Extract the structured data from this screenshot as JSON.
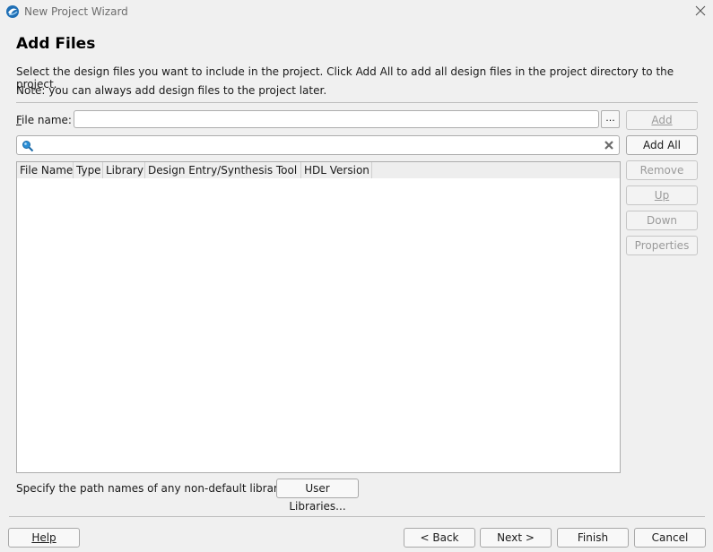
{
  "window": {
    "title": "New Project Wizard",
    "icon": "vivado-app-icon",
    "close_icon": "close-icon"
  },
  "page": {
    "heading": "Add Files",
    "description_line1": "Select the design files you want to include in the project. Click Add All to add all design files in the project directory to the project.",
    "description_line2": "Note: you can always add design files to the project later."
  },
  "file_name": {
    "label": "File name:",
    "value": "",
    "browse_label": "..."
  },
  "search": {
    "value": "",
    "search_icon": "search-icon",
    "clear_icon": "clear-icon"
  },
  "table": {
    "columns": [
      "File Name",
      "Type",
      "Library",
      "Design Entry/Synthesis Tool",
      "HDL Version"
    ],
    "rows": []
  },
  "side_buttons": [
    {
      "label": "Add",
      "enabled": false
    },
    {
      "label": "Add All",
      "enabled": true
    },
    {
      "label": "Remove",
      "enabled": false
    },
    {
      "label": "Up",
      "enabled": false
    },
    {
      "label": "Down",
      "enabled": false
    },
    {
      "label": "Properties",
      "enabled": false
    }
  ],
  "libraries": {
    "text": "Specify the path names of any non-default libraries.",
    "button_label": "User Libraries..."
  },
  "footer": {
    "help_label": "Help",
    "back_label": "< Back",
    "next_label": "Next >",
    "finish_label": "Finish",
    "cancel_label": "Cancel"
  }
}
